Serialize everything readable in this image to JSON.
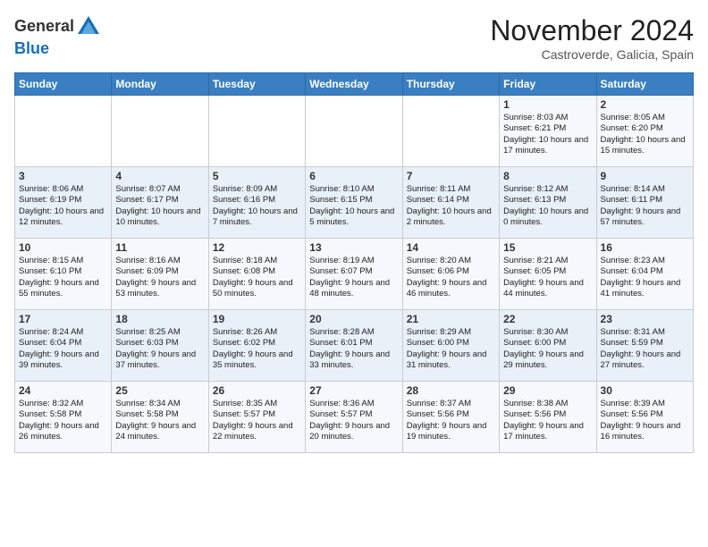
{
  "header": {
    "logo_line1": "General",
    "logo_line2": "Blue",
    "month": "November 2024",
    "location": "Castroverde, Galicia, Spain"
  },
  "days_of_week": [
    "Sunday",
    "Monday",
    "Tuesday",
    "Wednesday",
    "Thursday",
    "Friday",
    "Saturday"
  ],
  "weeks": [
    [
      {
        "day": "",
        "info": ""
      },
      {
        "day": "",
        "info": ""
      },
      {
        "day": "",
        "info": ""
      },
      {
        "day": "",
        "info": ""
      },
      {
        "day": "",
        "info": ""
      },
      {
        "day": "1",
        "info": "Sunrise: 8:03 AM\nSunset: 6:21 PM\nDaylight: 10 hours and 17 minutes."
      },
      {
        "day": "2",
        "info": "Sunrise: 8:05 AM\nSunset: 6:20 PM\nDaylight: 10 hours and 15 minutes."
      }
    ],
    [
      {
        "day": "3",
        "info": "Sunrise: 8:06 AM\nSunset: 6:19 PM\nDaylight: 10 hours and 12 minutes."
      },
      {
        "day": "4",
        "info": "Sunrise: 8:07 AM\nSunset: 6:17 PM\nDaylight: 10 hours and 10 minutes."
      },
      {
        "day": "5",
        "info": "Sunrise: 8:09 AM\nSunset: 6:16 PM\nDaylight: 10 hours and 7 minutes."
      },
      {
        "day": "6",
        "info": "Sunrise: 8:10 AM\nSunset: 6:15 PM\nDaylight: 10 hours and 5 minutes."
      },
      {
        "day": "7",
        "info": "Sunrise: 8:11 AM\nSunset: 6:14 PM\nDaylight: 10 hours and 2 minutes."
      },
      {
        "day": "8",
        "info": "Sunrise: 8:12 AM\nSunset: 6:13 PM\nDaylight: 10 hours and 0 minutes."
      },
      {
        "day": "9",
        "info": "Sunrise: 8:14 AM\nSunset: 6:11 PM\nDaylight: 9 hours and 57 minutes."
      }
    ],
    [
      {
        "day": "10",
        "info": "Sunrise: 8:15 AM\nSunset: 6:10 PM\nDaylight: 9 hours and 55 minutes."
      },
      {
        "day": "11",
        "info": "Sunrise: 8:16 AM\nSunset: 6:09 PM\nDaylight: 9 hours and 53 minutes."
      },
      {
        "day": "12",
        "info": "Sunrise: 8:18 AM\nSunset: 6:08 PM\nDaylight: 9 hours and 50 minutes."
      },
      {
        "day": "13",
        "info": "Sunrise: 8:19 AM\nSunset: 6:07 PM\nDaylight: 9 hours and 48 minutes."
      },
      {
        "day": "14",
        "info": "Sunrise: 8:20 AM\nSunset: 6:06 PM\nDaylight: 9 hours and 46 minutes."
      },
      {
        "day": "15",
        "info": "Sunrise: 8:21 AM\nSunset: 6:05 PM\nDaylight: 9 hours and 44 minutes."
      },
      {
        "day": "16",
        "info": "Sunrise: 8:23 AM\nSunset: 6:04 PM\nDaylight: 9 hours and 41 minutes."
      }
    ],
    [
      {
        "day": "17",
        "info": "Sunrise: 8:24 AM\nSunset: 6:04 PM\nDaylight: 9 hours and 39 minutes."
      },
      {
        "day": "18",
        "info": "Sunrise: 8:25 AM\nSunset: 6:03 PM\nDaylight: 9 hours and 37 minutes."
      },
      {
        "day": "19",
        "info": "Sunrise: 8:26 AM\nSunset: 6:02 PM\nDaylight: 9 hours and 35 minutes."
      },
      {
        "day": "20",
        "info": "Sunrise: 8:28 AM\nSunset: 6:01 PM\nDaylight: 9 hours and 33 minutes."
      },
      {
        "day": "21",
        "info": "Sunrise: 8:29 AM\nSunset: 6:00 PM\nDaylight: 9 hours and 31 minutes."
      },
      {
        "day": "22",
        "info": "Sunrise: 8:30 AM\nSunset: 6:00 PM\nDaylight: 9 hours and 29 minutes."
      },
      {
        "day": "23",
        "info": "Sunrise: 8:31 AM\nSunset: 5:59 PM\nDaylight: 9 hours and 27 minutes."
      }
    ],
    [
      {
        "day": "24",
        "info": "Sunrise: 8:32 AM\nSunset: 5:58 PM\nDaylight: 9 hours and 26 minutes."
      },
      {
        "day": "25",
        "info": "Sunrise: 8:34 AM\nSunset: 5:58 PM\nDaylight: 9 hours and 24 minutes."
      },
      {
        "day": "26",
        "info": "Sunrise: 8:35 AM\nSunset: 5:57 PM\nDaylight: 9 hours and 22 minutes."
      },
      {
        "day": "27",
        "info": "Sunrise: 8:36 AM\nSunset: 5:57 PM\nDaylight: 9 hours and 20 minutes."
      },
      {
        "day": "28",
        "info": "Sunrise: 8:37 AM\nSunset: 5:56 PM\nDaylight: 9 hours and 19 minutes."
      },
      {
        "day": "29",
        "info": "Sunrise: 8:38 AM\nSunset: 5:56 PM\nDaylight: 9 hours and 17 minutes."
      },
      {
        "day": "30",
        "info": "Sunrise: 8:39 AM\nSunset: 5:56 PM\nDaylight: 9 hours and 16 minutes."
      }
    ]
  ]
}
